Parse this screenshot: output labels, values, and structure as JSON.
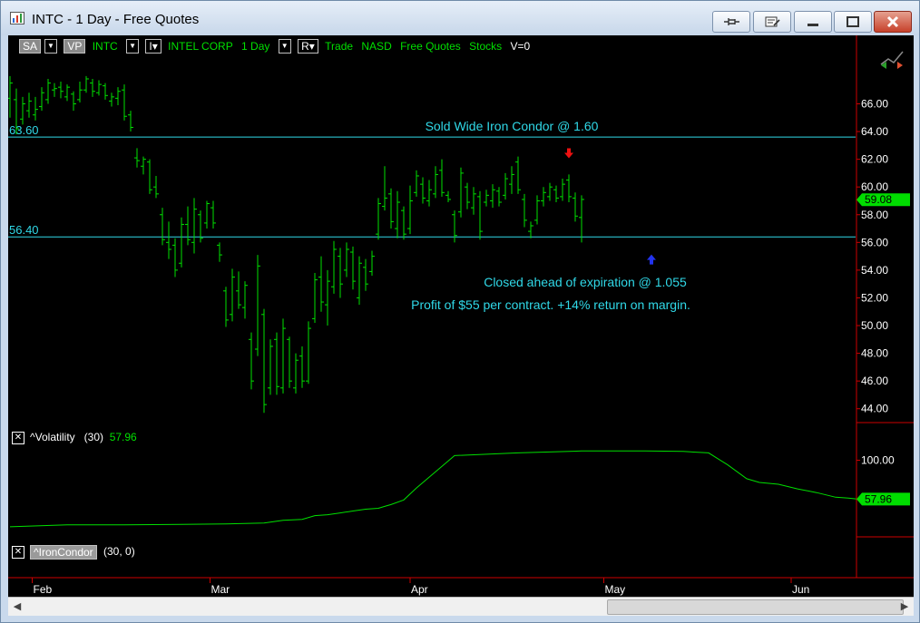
{
  "window": {
    "title": "INTC - 1 Day - Free Quotes"
  },
  "toolbar": {
    "sa": "SA",
    "vp": "VP",
    "symbol": "INTC",
    "i_label": "I",
    "company": "INTEL CORP",
    "interval": "1 Day",
    "r_label": "R",
    "trade": "Trade",
    "exchange": "NASD",
    "feed": "Free Quotes",
    "category": "Stocks",
    "volume": "V=0"
  },
  "colors": {
    "bars": "#00e000",
    "levels": "#30d9e8",
    "axis": "#cc0000",
    "annotation": "#30d9e8",
    "volatility": "#00e000"
  },
  "chart_data": [
    {
      "type": "ohlc",
      "symbol": "INTC",
      "ylim": [
        43,
        69.5
      ],
      "y_ticks": [
        44,
        46,
        48,
        50,
        52,
        54,
        56,
        58,
        60,
        62,
        64,
        66
      ],
      "y_tick_labels": [
        "44.00",
        "46.00",
        "48.00",
        "50.00",
        "52.00",
        "54.00",
        "56.00",
        "58.00",
        "60.00",
        "62.00",
        "64.00",
        "66.00"
      ],
      "x_labels": [
        "Feb",
        "Mar",
        "Apr",
        "May",
        "Jun"
      ],
      "last_price_label": "59.08",
      "last_price": 59.08,
      "levels": [
        {
          "value": 63.6,
          "label": "63.60"
        },
        {
          "value": 56.4,
          "label": "56.40"
        }
      ],
      "annotations": {
        "sold": "Sold Wide Iron Condor @ 1.60",
        "closed": "Closed ahead of expiration @ 1.055",
        "profit": "Profit of $55 per contract. +14% return on margin."
      },
      "markers": [
        {
          "type": "sell",
          "color": "#ee1111",
          "bar": 88,
          "value": 62.4
        },
        {
          "type": "buy",
          "color": "#2233ee",
          "bar": 101,
          "value": 54.8
        }
      ],
      "bars": [
        {
          "h": 68.0,
          "l": 65.0,
          "o": 66.4,
          "c": 67.5
        },
        {
          "h": 67.1,
          "l": 63.8,
          "o": 66.3,
          "c": 64.2
        },
        {
          "h": 66.5,
          "l": 64.5,
          "o": 64.9,
          "c": 66.0
        },
        {
          "h": 66.8,
          "l": 65.0,
          "o": 65.5,
          "c": 66.2
        },
        {
          "h": 66.5,
          "l": 64.8,
          "o": 65.2,
          "c": 65.6
        },
        {
          "h": 67.2,
          "l": 65.5,
          "o": 65.8,
          "c": 66.8
        },
        {
          "h": 67.8,
          "l": 66.0,
          "o": 66.3,
          "c": 67.5
        },
        {
          "h": 67.5,
          "l": 66.5,
          "o": 67.0,
          "c": 67.1
        },
        {
          "h": 67.6,
          "l": 66.4,
          "o": 67.2,
          "c": 66.9
        },
        {
          "h": 67.4,
          "l": 66.2,
          "o": 66.5,
          "c": 67.2
        },
        {
          "h": 66.9,
          "l": 65.5,
          "o": 66.7,
          "c": 66.0
        },
        {
          "h": 67.6,
          "l": 66.1,
          "o": 66.3,
          "c": 67.0
        },
        {
          "h": 68.0,
          "l": 66.8,
          "o": 67.0,
          "c": 67.8
        },
        {
          "h": 67.8,
          "l": 66.5,
          "o": 67.5,
          "c": 66.9
        },
        {
          "h": 67.7,
          "l": 66.6,
          "o": 66.8,
          "c": 67.4
        },
        {
          "h": 67.5,
          "l": 66.3,
          "o": 67.3,
          "c": 66.6
        },
        {
          "h": 66.8,
          "l": 65.8,
          "o": 66.2,
          "c": 66.5
        },
        {
          "h": 67.2,
          "l": 65.9,
          "o": 66.4,
          "c": 66.9
        },
        {
          "h": 67.4,
          "l": 64.8,
          "o": 67.0,
          "c": 65.1
        },
        {
          "h": 65.5,
          "l": 64.0,
          "o": 65.2,
          "c": 64.3
        },
        {
          "h": 62.8,
          "l": 61.4,
          "o": 62.1,
          "c": 61.9
        },
        {
          "h": 62.2,
          "l": 60.9,
          "o": 61.5,
          "c": 62.0
        },
        {
          "h": 62.0,
          "l": 59.5,
          "o": 61.8,
          "c": 59.8
        },
        {
          "h": 60.8,
          "l": 59.2,
          "o": 60.0,
          "c": 59.5
        },
        {
          "h": 58.5,
          "l": 55.8,
          "o": 58.0,
          "c": 56.2
        },
        {
          "h": 57.5,
          "l": 54.8,
          "o": 56.0,
          "c": 55.5
        },
        {
          "h": 56.3,
          "l": 53.5,
          "o": 55.8,
          "c": 54.0
        },
        {
          "h": 57.8,
          "l": 54.2,
          "o": 54.5,
          "c": 57.3
        },
        {
          "h": 58.6,
          "l": 55.8,
          "o": 57.3,
          "c": 56.2
        },
        {
          "h": 59.2,
          "l": 55.2,
          "o": 56.0,
          "c": 58.4
        },
        {
          "h": 58.3,
          "l": 56.0,
          "o": 58.0,
          "c": 56.3
        },
        {
          "h": 59.0,
          "l": 57.0,
          "o": 57.4,
          "c": 58.8
        },
        {
          "h": 59.0,
          "l": 57.0,
          "o": 58.5,
          "c": 57.4
        },
        {
          "h": 56.0,
          "l": 54.6,
          "o": 55.8,
          "c": 55.1
        },
        {
          "h": 52.8,
          "l": 49.9,
          "o": 52.5,
          "c": 50.4
        },
        {
          "h": 54.1,
          "l": 50.3,
          "o": 50.8,
          "c": 53.5
        },
        {
          "h": 53.9,
          "l": 51.2,
          "o": 52.5,
          "c": 51.5
        },
        {
          "h": 53.2,
          "l": 50.5,
          "o": 51.3,
          "c": 52.9
        },
        {
          "h": 49.5,
          "l": 45.4,
          "o": 49.0,
          "c": 46.0
        },
        {
          "h": 55.1,
          "l": 47.8,
          "o": 48.3,
          "c": 54.3
        },
        {
          "h": 51.2,
          "l": 43.7,
          "o": 50.8,
          "c": 44.3
        },
        {
          "h": 49.0,
          "l": 45.0,
          "o": 45.5,
          "c": 48.5
        },
        {
          "h": 49.5,
          "l": 45.0,
          "o": 49.0,
          "c": 45.6
        },
        {
          "h": 50.5,
          "l": 45.1,
          "o": 45.5,
          "c": 49.8
        },
        {
          "h": 49.2,
          "l": 45.5,
          "o": 49.0,
          "c": 46.0
        },
        {
          "h": 48.0,
          "l": 45.1,
          "o": 45.5,
          "c": 47.5
        },
        {
          "h": 48.5,
          "l": 45.5,
          "o": 47.8,
          "c": 46.0
        },
        {
          "h": 50.3,
          "l": 45.8,
          "o": 46.0,
          "c": 49.8
        },
        {
          "h": 53.8,
          "l": 50.2,
          "o": 50.5,
          "c": 53.3
        },
        {
          "h": 55.0,
          "l": 51.0,
          "o": 53.5,
          "c": 51.7
        },
        {
          "h": 54.0,
          "l": 50.0,
          "o": 51.5,
          "c": 53.2
        },
        {
          "h": 56.1,
          "l": 52.3,
          "o": 52.8,
          "c": 55.5
        },
        {
          "h": 55.6,
          "l": 52.0,
          "o": 55.0,
          "c": 53.0
        },
        {
          "h": 56.0,
          "l": 53.5,
          "o": 54.0,
          "c": 55.5
        },
        {
          "h": 55.7,
          "l": 52.6,
          "o": 55.3,
          "c": 53.2
        },
        {
          "h": 55.0,
          "l": 51.5,
          "o": 52.0,
          "c": 54.5
        },
        {
          "h": 54.8,
          "l": 52.5,
          "o": 54.2,
          "c": 53.0
        },
        {
          "h": 55.4,
          "l": 53.6,
          "o": 53.9,
          "c": 55.0
        },
        {
          "h": 59.2,
          "l": 56.2,
          "o": 56.6,
          "c": 58.8
        },
        {
          "h": 61.5,
          "l": 58.3,
          "o": 58.6,
          "c": 59.2
        },
        {
          "h": 59.9,
          "l": 57.0,
          "o": 59.5,
          "c": 57.5
        },
        {
          "h": 59.7,
          "l": 56.3,
          "o": 57.0,
          "c": 58.9
        },
        {
          "h": 58.6,
          "l": 56.2,
          "o": 58.3,
          "c": 56.6
        },
        {
          "h": 60.1,
          "l": 56.6,
          "o": 57.0,
          "c": 59.0
        },
        {
          "h": 61.2,
          "l": 59.3,
          "o": 59.6,
          "c": 60.8
        },
        {
          "h": 60.7,
          "l": 58.8,
          "o": 60.2,
          "c": 59.2
        },
        {
          "h": 60.5,
          "l": 58.6,
          "o": 59.0,
          "c": 59.8
        },
        {
          "h": 61.5,
          "l": 59.2,
          "o": 59.5,
          "c": 60.9
        },
        {
          "h": 62.0,
          "l": 59.3,
          "o": 61.2,
          "c": 59.6
        },
        {
          "h": 59.7,
          "l": 58.9,
          "o": 59.4,
          "c": 59.1
        },
        {
          "h": 58.3,
          "l": 56.0,
          "o": 58.0,
          "c": 56.5
        },
        {
          "h": 61.4,
          "l": 57.8,
          "o": 58.2,
          "c": 61.0
        },
        {
          "h": 60.3,
          "l": 58.4,
          "o": 60.0,
          "c": 58.9
        },
        {
          "h": 60.0,
          "l": 58.0,
          "o": 58.5,
          "c": 59.5
        },
        {
          "h": 59.7,
          "l": 56.2,
          "o": 59.3,
          "c": 56.8
        },
        {
          "h": 59.8,
          "l": 58.6,
          "o": 58.9,
          "c": 59.4
        },
        {
          "h": 60.2,
          "l": 58.5,
          "o": 59.0,
          "c": 59.8
        },
        {
          "h": 60.0,
          "l": 58.6,
          "o": 59.7,
          "c": 58.9
        },
        {
          "h": 61.0,
          "l": 59.1,
          "o": 59.4,
          "c": 60.6
        },
        {
          "h": 61.5,
          "l": 59.5,
          "o": 60.2,
          "c": 60.9
        },
        {
          "h": 62.2,
          "l": 59.5,
          "o": 61.8,
          "c": 59.8
        },
        {
          "h": 59.5,
          "l": 57.1,
          "o": 59.1,
          "c": 57.6
        },
        {
          "h": 57.5,
          "l": 56.3,
          "o": 56.8,
          "c": 57.2
        },
        {
          "h": 59.4,
          "l": 57.3,
          "o": 57.6,
          "c": 59.0
        },
        {
          "h": 60.0,
          "l": 58.6,
          "o": 59.0,
          "c": 59.6
        },
        {
          "h": 60.3,
          "l": 59.0,
          "o": 59.3,
          "c": 60.0
        },
        {
          "h": 60.1,
          "l": 58.9,
          "o": 59.8,
          "c": 59.2
        },
        {
          "h": 60.6,
          "l": 59.0,
          "o": 59.3,
          "c": 60.2
        },
        {
          "h": 60.9,
          "l": 58.9,
          "o": 60.5,
          "c": 59.3
        },
        {
          "h": 59.6,
          "l": 57.5,
          "o": 59.2,
          "c": 57.9
        },
        {
          "h": 59.4,
          "l": 56.0,
          "o": 57.8,
          "c": 59.1
        }
      ]
    },
    {
      "type": "line",
      "name": "^Volatility",
      "period_label": "(30)",
      "last_label": "57.96",
      "tick_label": "100.00",
      "ylim": [
        20,
        128
      ],
      "tick_value": 100,
      "last_value": 57.96,
      "x_index": [
        0,
        9,
        18,
        27,
        34,
        40,
        43,
        46,
        48,
        50,
        52,
        54,
        56,
        58,
        59,
        60,
        62,
        64,
        70,
        80,
        90,
        100,
        106,
        110,
        113,
        116,
        118,
        121,
        124,
        127,
        130,
        132,
        134,
        136
      ],
      "values": [
        28,
        30,
        30,
        30.5,
        31,
        32,
        35,
        36,
        40,
        41,
        43,
        45,
        47,
        48,
        50,
        52,
        57,
        70,
        105,
        108,
        110,
        110,
        109.5,
        108,
        95,
        80,
        76,
        74,
        69,
        65,
        60,
        59,
        57.5,
        57.96
      ]
    },
    {
      "type": "indicator",
      "name": "^IronCondor",
      "params": "(30,  0)"
    }
  ]
}
